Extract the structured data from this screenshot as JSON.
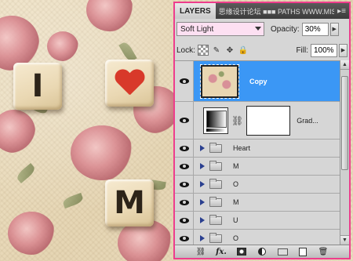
{
  "canvas": {
    "tiles": [
      {
        "id": "tile-i",
        "letter": "I"
      },
      {
        "id": "tile-heart",
        "symbol": "heart"
      },
      {
        "id": "tile-m",
        "letter": "M"
      }
    ],
    "colors": {
      "heart": "#d8392a",
      "tile": "#eddcb8",
      "paper": "#e9dcc0"
    }
  },
  "panel": {
    "tab_label": "LAYERS",
    "other_tabs_text": "思缘设计论坛 ■■■ PATHS    WWW.MISSYUAN.COM",
    "menu_icon": "panel-menu-icon",
    "blend_mode": "Soft Light",
    "opacity_label": "Opacity:",
    "opacity_value": "30%",
    "lock_label": "Lock:",
    "fill_label": "Fill:",
    "fill_value": "100%",
    "accent_color": "#3b97f5",
    "border_color": "#ee3d8c",
    "layers": [
      {
        "name": "Copy",
        "type": "pixel",
        "selected": true
      },
      {
        "name": "Grad...",
        "type": "adjustment",
        "selected": false
      },
      {
        "name": "Heart",
        "type": "group"
      },
      {
        "name": "M",
        "type": "group"
      },
      {
        "name": "O",
        "type": "group"
      },
      {
        "name": "M",
        "type": "group"
      },
      {
        "name": "U",
        "type": "group"
      },
      {
        "name": "O",
        "type": "group"
      }
    ],
    "bottom_icons": [
      "link-icon",
      "fx-icon",
      "mask-icon",
      "adjustment-icon",
      "new-group-icon",
      "new-layer-icon",
      "trash-icon"
    ]
  }
}
